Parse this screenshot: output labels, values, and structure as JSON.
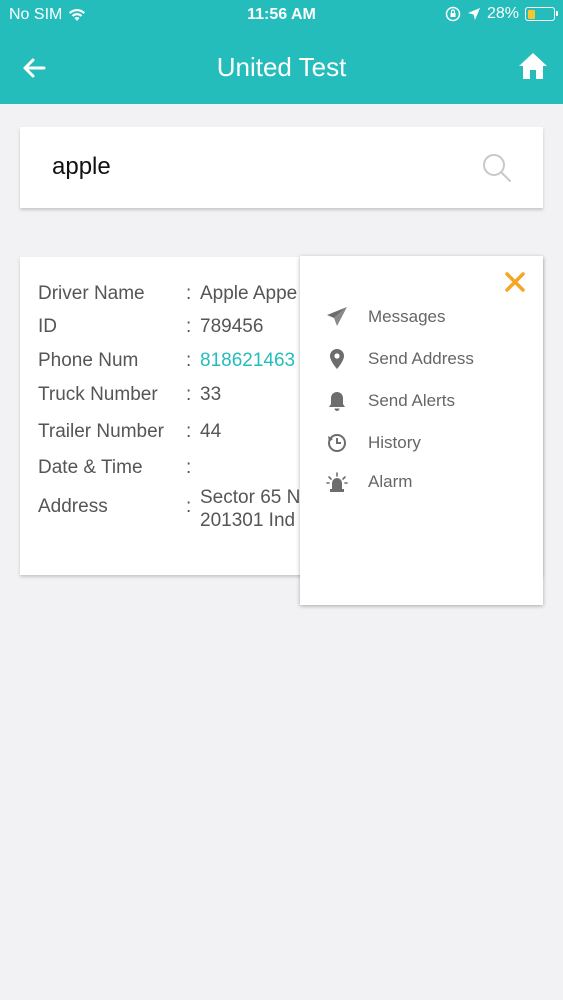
{
  "status_bar": {
    "carrier": "No SIM",
    "time": "11:56 AM",
    "battery": "28%",
    "battery_level": 0.28
  },
  "header": {
    "title": "United Test"
  },
  "search": {
    "value": "apple",
    "placeholder": ""
  },
  "driver_card": {
    "rows": [
      {
        "label": "Driver Name",
        "value": "Apple Appe"
      },
      {
        "label": "ID",
        "value": "789456"
      },
      {
        "label": "Phone Num",
        "value": "818621463"
      },
      {
        "label": "Truck Number",
        "value": "33"
      },
      {
        "label": "Trailer Number",
        "value": "44"
      },
      {
        "label": "Date & Time",
        "value": ""
      },
      {
        "label": "Address",
        "value": "Sector 65 N",
        "value2": "201301 Ind"
      }
    ],
    "separator": ":"
  },
  "action_menu": {
    "items": [
      {
        "label": "Messages",
        "icon": "paper-plane-icon"
      },
      {
        "label": "Send Address",
        "icon": "location-pin-icon"
      },
      {
        "label": "Send Alerts",
        "icon": "bell-icon"
      },
      {
        "label": "History",
        "icon": "clock-history-icon"
      },
      {
        "label": "Alarm",
        "icon": "alarm-light-icon"
      }
    ]
  },
  "colors": {
    "accent": "#24bdbb",
    "close": "#f5a623",
    "background": "#f2f2f4"
  }
}
